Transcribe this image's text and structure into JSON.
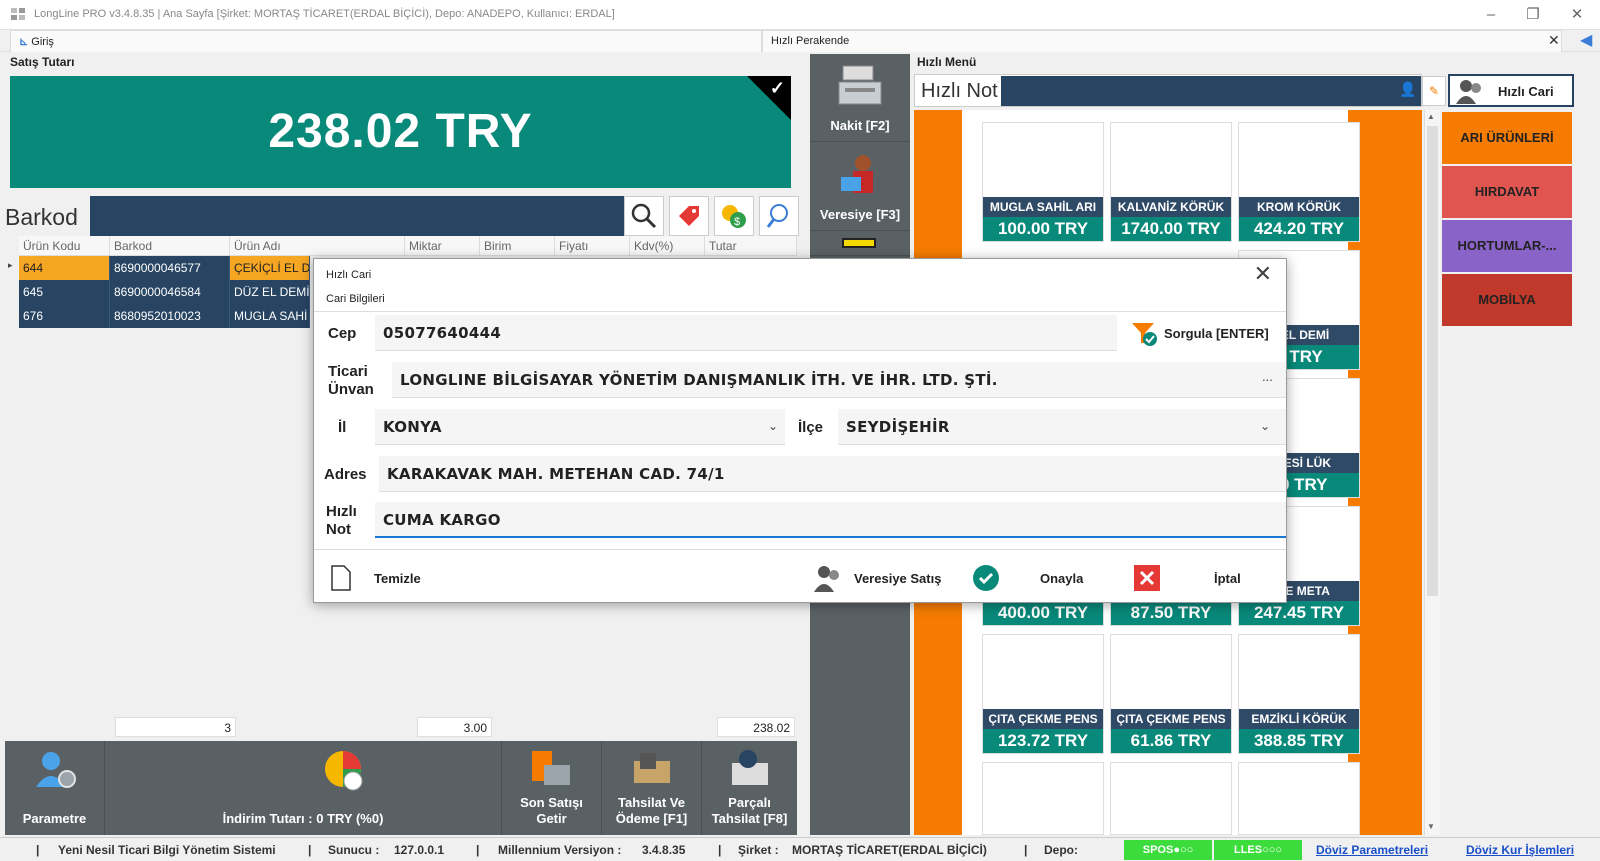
{
  "window": {
    "title": "LongLine PRO v3.4.8.35 | Ana Sayfa [Şirket: MORTAŞ TİCARET(ERDAL BİÇİCİ), Depo: ANADEPO, Kullanıcı: ERDAL]"
  },
  "tabs": [
    {
      "label": "Giriş"
    },
    {
      "label": "Hızlı Perakende"
    }
  ],
  "satis": {
    "section_label": "Satış Tutarı",
    "total": "238.02 TRY"
  },
  "barkod": {
    "label": "Barkod"
  },
  "grid": {
    "headers": [
      "Ürün Kodu",
      "Barkod",
      "Ürün Adı",
      "Miktar",
      "Birim",
      "Fiyatı",
      "Kdv(%)",
      "Tutar"
    ],
    "rows": [
      {
        "kod": "644",
        "barkod": "8690000046577",
        "ad": "ÇEKİÇLİ EL D"
      },
      {
        "kod": "645",
        "barkod": "8690000046584",
        "ad": "DÜZ EL DEMİ"
      },
      {
        "kod": "676",
        "barkod": "8680952010023",
        "ad": "MUGLA SAHİ"
      }
    ],
    "footer": {
      "count": "3",
      "miktar": "3.00",
      "tutar": "238.02"
    }
  },
  "bottom_buttons": {
    "parametre": "Parametre",
    "indirim": "İndirim Tutarı : 0 TRY (%0)",
    "son_satis_1": "Son Satışı",
    "son_satis_2": "Getir",
    "tahsilat_1": "Tahsilat Ve",
    "tahsilat_2": "Ödeme [F1]",
    "parcali_1": "Parçalı",
    "parcali_2": "Tahsilat [F8]"
  },
  "side_buttons": {
    "nakit": "Nakit [F2]",
    "veresiye": "Veresiye [F3]"
  },
  "hizli_menu": {
    "title": "Hızlı Menü",
    "hizli_not_label": "Hızlı Not",
    "hizli_cari_label": "Hızlı Cari"
  },
  "products": [
    {
      "name": "MUGLA SAHİL ARI",
      "price": "100.00 TRY"
    },
    {
      "name": "KALVANİZ KÖRÜK",
      "price": "1740.00 TRY"
    },
    {
      "name": "KROM KÖRÜK",
      "price": "424.20 TRY"
    },
    {
      "name": "K EL DEMİ",
      "price": "9 TRY"
    },
    {
      "name": "SKESİ LÜK",
      "price": "00 TRY"
    },
    {
      "name": "",
      "price": "400.00 TRY"
    },
    {
      "name": "",
      "price": "87.50 TRY"
    },
    {
      "name": "LME META",
      "price": "247.45 TRY"
    },
    {
      "name": "ÇITA ÇEKME PENS",
      "price": "123.72 TRY"
    },
    {
      "name": "ÇITA ÇEKME PENS",
      "price": "61.86 TRY"
    },
    {
      "name": "EMZİKLİ KÖRÜK",
      "price": "388.85 TRY"
    }
  ],
  "categories": [
    {
      "label": "ARI ÜRÜNLERİ",
      "color": "#f57c00"
    },
    {
      "label": "HIRDAVAT",
      "color": "#e05550"
    },
    {
      "label": "HORTUMLAR-...",
      "color": "#8a63c9"
    },
    {
      "label": "MOBİLYA",
      "color": "#c0392b"
    }
  ],
  "dialog": {
    "title": "Hızlı Cari",
    "subtitle": "Cari Bilgileri",
    "cep_label": "Cep",
    "cep_value": "05077640444",
    "sorgula_label": "Sorgula [ENTER]",
    "ticari_label_1": "Ticari",
    "ticari_label_2": "Ünvan",
    "ticari_value": "LONGLINE BİLGİSAYAR YÖNETİM DANIŞMANLIK İTH. VE İHR. LTD. ŞTİ.",
    "ellipsis": "...",
    "il_label": "İl",
    "il_value": "KONYA",
    "ilce_label": "İlçe",
    "ilce_value": "SEYDİŞEHİR",
    "adres_label": "Adres",
    "adres_value": "KARAKAVAK MAH. METEHAN CAD. 74/1",
    "not_label_1": "Hızlı",
    "not_label_2": "Not",
    "not_value": "CUMA KARGO",
    "temizle": "Temizle",
    "veresiye": "Veresiye Satış",
    "onayla": "Onayla",
    "iptal": "İptal"
  },
  "statusbar": {
    "system": "Yeni Nesil Ticari Bilgi Yönetim Sistemi",
    "sunucu_label": "Sunucu :",
    "sunucu_value": "127.0.0.1",
    "versiyon_label": "Millennium Versiyon :",
    "versiyon_value": "3.4.8.35",
    "sirket_label": "Şirket :",
    "sirket_value": "MORTAŞ TİCARET(ERDAL BİÇİCİ)",
    "depo_label": "Depo:",
    "spos": "SPOS●○○",
    "lles": "LLES○○○",
    "doviz_param": "Döviz Parametreleri",
    "doviz_kur": "Döviz Kur İşlemleri"
  }
}
